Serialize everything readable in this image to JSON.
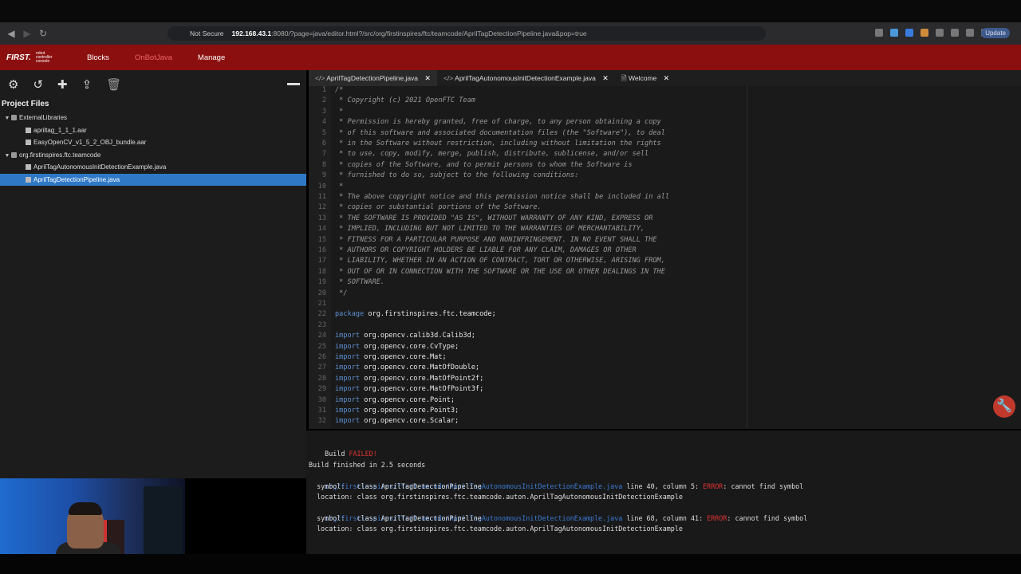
{
  "browser": {
    "not_secure": "Not Secure",
    "url_host": "192.168.43.1",
    "url_path": ":8080/?page=java/editor.html?/src/org/firstinspires/ftc/teamcode/AprilTagDetectionPipeline.java&pop=true",
    "update_label": "Update"
  },
  "app": {
    "logo": "FIRST.",
    "logo_sub": "robot controller console",
    "nav": [
      "Blocks",
      "OnBotJava",
      "Manage"
    ]
  },
  "sidebar": {
    "title": "Project Files",
    "tree": [
      {
        "label": "ExternalLibraries",
        "type": "folder",
        "depth": 0
      },
      {
        "label": "apriltag_1_1_1.aar",
        "type": "file",
        "depth": 1
      },
      {
        "label": "EasyOpenCV_v1_5_2_OBJ_bundle.aar",
        "type": "file",
        "depth": 1
      },
      {
        "label": "org.firstinspires.ftc.teamcode",
        "type": "folder",
        "depth": 0
      },
      {
        "label": "AprilTagAutonomousInitDetectionExample.java",
        "type": "file",
        "depth": 1
      },
      {
        "label": "AprilTagDetectionPipeline.java",
        "type": "file",
        "depth": 1,
        "selected": true
      }
    ]
  },
  "tabs": [
    {
      "label": "AprilTagDetectionPipeline.java",
      "active": true
    },
    {
      "label": "AprilTagAutonomousInitDetectionExample.java",
      "active": false
    },
    {
      "label": "Welcome",
      "active": false
    }
  ],
  "code_lines": [
    {
      "n": "1",
      "t": "/*",
      "k": "cmt"
    },
    {
      "n": "2",
      "t": " * Copyright (c) 2021 OpenFTC Team",
      "k": "cmt"
    },
    {
      "n": "3",
      "t": " *",
      "k": "cmt"
    },
    {
      "n": "4",
      "t": " * Permission is hereby granted, free of charge, to any person obtaining a copy",
      "k": "cmt"
    },
    {
      "n": "5",
      "t": " * of this software and associated documentation files (the \"Software\"), to deal",
      "k": "cmt"
    },
    {
      "n": "6",
      "t": " * in the Software without restriction, including without limitation the rights",
      "k": "cmt"
    },
    {
      "n": "7",
      "t": " * to use, copy, modify, merge, publish, distribute, sublicense, and/or sell",
      "k": "cmt"
    },
    {
      "n": "8",
      "t": " * copies of the Software, and to permit persons to whom the Software is",
      "k": "cmt"
    },
    {
      "n": "9",
      "t": " * furnished to do so, subject to the following conditions:",
      "k": "cmt"
    },
    {
      "n": "10",
      "t": " *",
      "k": "cmt"
    },
    {
      "n": "11",
      "t": " * The above copyright notice and this permission notice shall be included in all",
      "k": "cmt"
    },
    {
      "n": "12",
      "t": " * copies or substantial portions of the Software.",
      "k": "cmt"
    },
    {
      "n": "13",
      "t": " * THE SOFTWARE IS PROVIDED \"AS IS\", WITHOUT WARRANTY OF ANY KIND, EXPRESS OR",
      "k": "cmt"
    },
    {
      "n": "14",
      "t": " * IMPLIED, INCLUDING BUT NOT LIMITED TO THE WARRANTIES OF MERCHANTABILITY,",
      "k": "cmt"
    },
    {
      "n": "15",
      "t": " * FITNESS FOR A PARTICULAR PURPOSE AND NONINFRINGEMENT. IN NO EVENT SHALL THE",
      "k": "cmt"
    },
    {
      "n": "16",
      "t": " * AUTHORS OR COPYRIGHT HOLDERS BE LIABLE FOR ANY CLAIM, DAMAGES OR OTHER",
      "k": "cmt"
    },
    {
      "n": "17",
      "t": " * LIABILITY, WHETHER IN AN ACTION OF CONTRACT, TORT OR OTHERWISE, ARISING FROM,",
      "k": "cmt"
    },
    {
      "n": "18",
      "t": " * OUT OF OR IN CONNECTION WITH THE SOFTWARE OR THE USE OR OTHER DEALINGS IN THE",
      "k": "cmt"
    },
    {
      "n": "19",
      "t": " * SOFTWARE.",
      "k": "cmt"
    },
    {
      "n": "20",
      "t": " */",
      "k": "cmt"
    },
    {
      "n": "21",
      "t": "",
      "k": "pl"
    },
    {
      "n": "22",
      "kw": "package",
      "t": " org.firstinspires.ftc.teamcode;",
      "k": "pl"
    },
    {
      "n": "23",
      "t": "",
      "k": "pl"
    },
    {
      "n": "24",
      "kw": "import",
      "t": " org.opencv.calib3d.Calib3d;",
      "k": "pl"
    },
    {
      "n": "25",
      "kw": "import",
      "t": " org.opencv.core.CvType;",
      "k": "pl"
    },
    {
      "n": "26",
      "kw": "import",
      "t": " org.opencv.core.Mat;",
      "k": "pl"
    },
    {
      "n": "27",
      "kw": "import",
      "t": " org.opencv.core.MatOfDouble;",
      "k": "pl"
    },
    {
      "n": "28",
      "kw": "import",
      "t": " org.opencv.core.MatOfPoint2f;",
      "k": "pl"
    },
    {
      "n": "29",
      "kw": "import",
      "t": " org.opencv.core.MatOfPoint3f;",
      "k": "pl"
    },
    {
      "n": "30",
      "kw": "import",
      "t": " org.opencv.core.Point;",
      "k": "pl"
    },
    {
      "n": "31",
      "kw": "import",
      "t": " org.opencv.core.Point3;",
      "k": "pl"
    },
    {
      "n": "32",
      "kw": "import",
      "t": " org.opencv.core.Scalar;",
      "k": "pl"
    }
  ],
  "console": {
    "build_label": "Build",
    "failed": "FAILED!",
    "finished": "Build finished in 2.5 seconds",
    "errors": [
      {
        "path": "org/firstinspires/ftc/teamcode/AprilTagAutonomousInitDetectionExample.java",
        "where": " line 40, column 5: ",
        "err": "ERROR",
        "msg": ": cannot find symbol",
        "symbol": "  symbol:   class AprilTagDetectionPipeline",
        "location": "  location: class org.firstinspires.ftc.teamcode.auton.AprilTagAutonomousInitDetectionExample"
      },
      {
        "path": "org/firstinspires/ftc/teamcode/AprilTagAutonomousInitDetectionExample.java",
        "where": " line 68, column 41: ",
        "err": "ERROR",
        "msg": ": cannot find symbol",
        "symbol": "  symbol:   class AprilTagDetectionPipeline",
        "location": "  location: class org.firstinspires.ftc.teamcode.auton.AprilTagAutonomousInitDetectionExample"
      }
    ]
  },
  "icons": {
    "settings": "gear-icon",
    "undo": "undo-icon",
    "add": "plus-icon",
    "upload": "upload-icon",
    "delete": "trash-icon",
    "tools": "wrench-icon"
  }
}
